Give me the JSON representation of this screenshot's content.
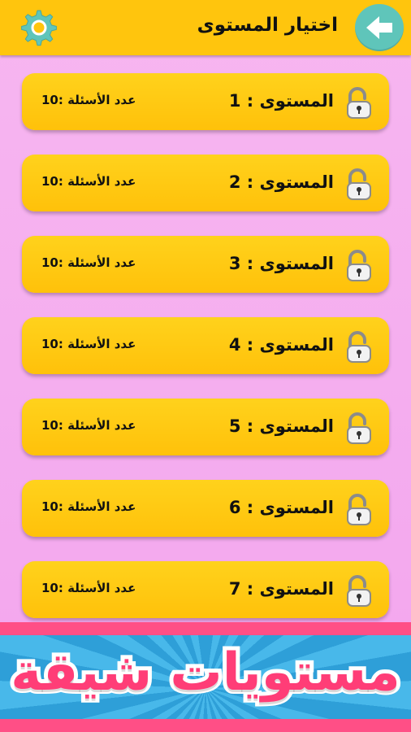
{
  "header": {
    "title": "اختيار المستوى",
    "settings_icon": "gear-icon",
    "back_icon": "arrow-back-icon"
  },
  "levels": [
    {
      "label": "المستوى : 1",
      "count": "عدد الأسئلة :10"
    },
    {
      "label": "المستوى : 2",
      "count": "عدد الأسئلة :10"
    },
    {
      "label": "المستوى : 3",
      "count": "عدد الأسئلة :10"
    },
    {
      "label": "المستوى : 4",
      "count": "عدد الأسئلة :10"
    },
    {
      "label": "المستوى : 5",
      "count": "عدد الأسئلة :10"
    },
    {
      "label": "المستوى : 6",
      "count": "عدد الأسئلة :10"
    },
    {
      "label": "المستوى : 7",
      "count": "عدد الأسئلة :10"
    }
  ],
  "banner": {
    "text": "مستويات شيقة"
  },
  "colors": {
    "header": "#ffc50d",
    "background": "#f5adee",
    "level_button": "#ffc80f",
    "back_button": "#5fc5ba",
    "gear": "#5fc5ba",
    "banner_text": "#ff3d77",
    "banner_bg": "#3aa9e0"
  }
}
